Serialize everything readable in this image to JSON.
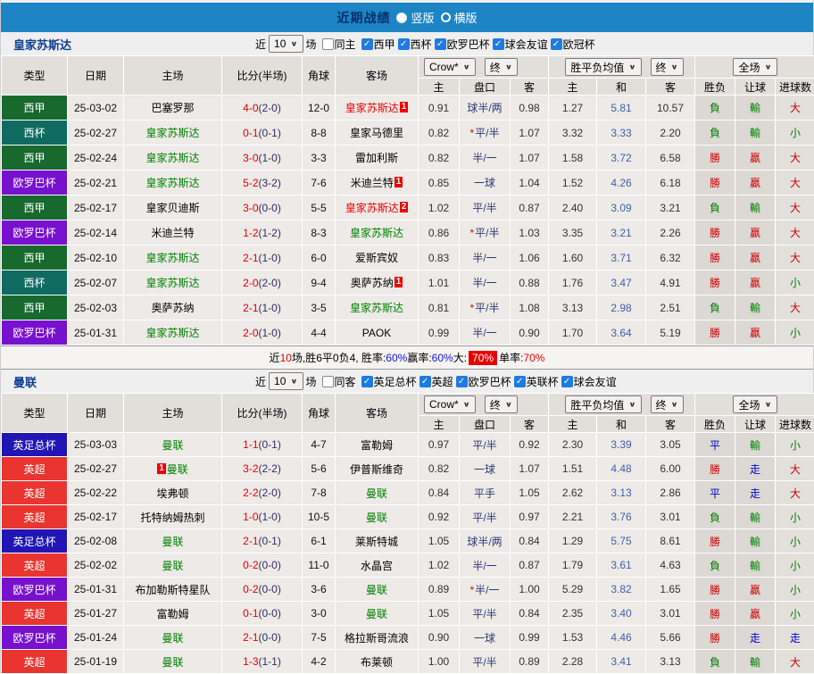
{
  "title_bar": {
    "title": "近期战绩",
    "vertical_label": "竖版",
    "horizontal_label": "横版",
    "selected": "竖版"
  },
  "colors": {
    "accent_bar": "#1d84c5",
    "league": {
      "西甲": "#17692e",
      "西杯": "#0f6a60",
      "欧罗巴杯": "#7711ce",
      "英足总杯": "#2015b5",
      "英超": "#e93430"
    },
    "team": {
      "green": "#018001",
      "red": "#f20000",
      "black": "#000000"
    },
    "result": {
      "red": "#cc0101",
      "green": "#028102",
      "blue": "#0101cc"
    }
  },
  "filter_common": {
    "near": "近",
    "games": "10",
    "games_suffix": "场"
  },
  "columns": {
    "type": "类型",
    "date": "日期",
    "home": "主场",
    "score": "比分(半场)",
    "corner": "角球",
    "away": "客场",
    "odds_home": "主",
    "odds_hcap": "盘口",
    "odds_away": "客",
    "avg_home": "主",
    "avg_draw": "和",
    "avg_away": "客",
    "result_wdl": "胜负",
    "result_hcap": "让球",
    "result_goal": "进球数",
    "select_crow": "Crow*",
    "select_final1": "终",
    "select_avg": "胜平负均值",
    "select_final2": "终",
    "select_full": "全场"
  },
  "sections": [
    {
      "team": "皇家苏斯达",
      "venue_label": "同主",
      "venue_checked": false,
      "leagues": [
        {
          "label": "西甲",
          "checked": true
        },
        {
          "label": "西杯",
          "checked": true
        },
        {
          "label": "欧罗巴杯",
          "checked": true
        },
        {
          "label": "球会友谊",
          "checked": true
        },
        {
          "label": "欧冠杯",
          "checked": true
        }
      ],
      "rows": [
        {
          "lg": "西甲",
          "dt": "25-03-02",
          "hm": {
            "n": "巴塞罗那",
            "c": "black"
          },
          "sc": "4-0",
          "hf": "(2-0)",
          "cn": "12-0",
          "aw": {
            "n": "皇家苏斯达",
            "c": "red",
            "b": "1"
          },
          "o1": "0.91",
          "hc": "球半/两",
          "st": false,
          "o2": "0.98",
          "m1": "1.27",
          "m2": "5.81",
          "m3": "10.57",
          "r1": [
            "負",
            "green"
          ],
          "r2": [
            "輸",
            "green"
          ],
          "r3": [
            "大",
            "red"
          ]
        },
        {
          "lg": "西杯",
          "dt": "25-02-27",
          "hm": {
            "n": "皇家苏斯达",
            "c": "green"
          },
          "sc": "0-1",
          "hf": "(0-1)",
          "cn": "8-8",
          "aw": {
            "n": "皇家马德里",
            "c": "black"
          },
          "o1": "0.82",
          "hc": "平/半",
          "st": true,
          "o2": "1.07",
          "m1": "3.32",
          "m2": "3.33",
          "m3": "2.20",
          "r1": [
            "負",
            "green"
          ],
          "r2": [
            "輸",
            "green"
          ],
          "r3": [
            "小",
            "green"
          ]
        },
        {
          "lg": "西甲",
          "dt": "25-02-24",
          "hm": {
            "n": "皇家苏斯达",
            "c": "green"
          },
          "sc": "3-0",
          "hf": "(1-0)",
          "cn": "3-3",
          "aw": {
            "n": "雷加利斯",
            "c": "black"
          },
          "o1": "0.82",
          "hc": "半/一",
          "st": false,
          "o2": "1.07",
          "m1": "1.58",
          "m2": "3.72",
          "m3": "6.58",
          "r1": [
            "勝",
            "red"
          ],
          "r2": [
            "贏",
            "red"
          ],
          "r3": [
            "大",
            "red"
          ]
        },
        {
          "lg": "欧罗巴杯",
          "dt": "25-02-21",
          "hm": {
            "n": "皇家苏斯达",
            "c": "green"
          },
          "sc": "5-2",
          "hf": "(3-2)",
          "cn": "7-6",
          "aw": {
            "n": "米迪兰特",
            "c": "black",
            "b": "1"
          },
          "o1": "0.85",
          "hc": "一球",
          "st": false,
          "o2": "1.04",
          "m1": "1.52",
          "m2": "4.26",
          "m3": "6.18",
          "r1": [
            "勝",
            "red"
          ],
          "r2": [
            "贏",
            "red"
          ],
          "r3": [
            "大",
            "red"
          ]
        },
        {
          "lg": "西甲",
          "dt": "25-02-17",
          "hm": {
            "n": "皇家贝迪斯",
            "c": "black"
          },
          "sc": "3-0",
          "hf": "(0-0)",
          "cn": "5-5",
          "aw": {
            "n": "皇家苏斯达",
            "c": "red",
            "b": "2"
          },
          "o1": "1.02",
          "hc": "平/半",
          "st": false,
          "o2": "0.87",
          "m1": "2.40",
          "m2": "3.09",
          "m3": "3.21",
          "r1": [
            "負",
            "green"
          ],
          "r2": [
            "輸",
            "green"
          ],
          "r3": [
            "大",
            "red"
          ]
        },
        {
          "lg": "欧罗巴杯",
          "dt": "25-02-14",
          "hm": {
            "n": "米迪兰特",
            "c": "black"
          },
          "sc": "1-2",
          "hf": "(1-2)",
          "cn": "8-3",
          "aw": {
            "n": "皇家苏斯达",
            "c": "green"
          },
          "o1": "0.86",
          "hc": "平/半",
          "st": true,
          "o2": "1.03",
          "m1": "3.35",
          "m2": "3.21",
          "m3": "2.26",
          "r1": [
            "勝",
            "red"
          ],
          "r2": [
            "贏",
            "red"
          ],
          "r3": [
            "大",
            "red"
          ]
        },
        {
          "lg": "西甲",
          "dt": "25-02-10",
          "hm": {
            "n": "皇家苏斯达",
            "c": "green"
          },
          "sc": "2-1",
          "hf": "(1-0)",
          "cn": "6-0",
          "aw": {
            "n": "爱斯宾奴",
            "c": "black"
          },
          "o1": "0.83",
          "hc": "半/一",
          "st": false,
          "o2": "1.06",
          "m1": "1.60",
          "m2": "3.71",
          "m3": "6.32",
          "r1": [
            "勝",
            "red"
          ],
          "r2": [
            "贏",
            "red"
          ],
          "r3": [
            "大",
            "red"
          ]
        },
        {
          "lg": "西杯",
          "dt": "25-02-07",
          "hm": {
            "n": "皇家苏斯达",
            "c": "green"
          },
          "sc": "2-0",
          "hf": "(2-0)",
          "cn": "9-4",
          "aw": {
            "n": "奥萨苏纳",
            "c": "black",
            "b": "1"
          },
          "o1": "1.01",
          "hc": "半/一",
          "st": false,
          "o2": "0.88",
          "m1": "1.76",
          "m2": "3.47",
          "m3": "4.91",
          "r1": [
            "勝",
            "red"
          ],
          "r2": [
            "贏",
            "red"
          ],
          "r3": [
            "小",
            "green"
          ]
        },
        {
          "lg": "西甲",
          "dt": "25-02-03",
          "hm": {
            "n": "奥萨苏纳",
            "c": "black"
          },
          "sc": "2-1",
          "hf": "(1-0)",
          "cn": "3-5",
          "aw": {
            "n": "皇家苏斯达",
            "c": "green"
          },
          "o1": "0.81",
          "hc": "平/半",
          "st": true,
          "o2": "1.08",
          "m1": "3.13",
          "m2": "2.98",
          "m3": "2.51",
          "r1": [
            "負",
            "green"
          ],
          "r2": [
            "輸",
            "green"
          ],
          "r3": [
            "大",
            "red"
          ]
        },
        {
          "lg": "欧罗巴杯",
          "dt": "25-01-31",
          "hm": {
            "n": "皇家苏斯达",
            "c": "green"
          },
          "sc": "2-0",
          "hf": "(1-0)",
          "cn": "4-4",
          "aw": {
            "n": "PAOK",
            "c": "black"
          },
          "o1": "0.99",
          "hc": "半/一",
          "st": false,
          "o2": "0.90",
          "m1": "1.70",
          "m2": "3.64",
          "m3": "5.19",
          "r1": [
            "勝",
            "red"
          ],
          "r2": [
            "贏",
            "red"
          ],
          "r3": [
            "小",
            "green"
          ]
        }
      ],
      "summary": [
        {
          "t": "近",
          "s": "plain"
        },
        {
          "t": "10",
          "s": "red"
        },
        {
          "t": "场,胜6平0负4, 胜率:",
          "s": "plain"
        },
        {
          "t": "60%",
          "s": "blue"
        },
        {
          "t": " 赢率:",
          "s": "plain"
        },
        {
          "t": "60%",
          "s": "blue"
        },
        {
          "t": " 大:",
          "s": "plain"
        },
        {
          "t": "70%",
          "s": "badge"
        },
        {
          "t": " 单率:",
          "s": "plain"
        },
        {
          "t": "70%",
          "s": "red"
        }
      ]
    },
    {
      "team": "曼联",
      "venue_label": "同客",
      "venue_checked": false,
      "leagues": [
        {
          "label": "英足总杯",
          "checked": true
        },
        {
          "label": "英超",
          "checked": true
        },
        {
          "label": "欧罗巴杯",
          "checked": true
        },
        {
          "label": "英联杯",
          "checked": true
        },
        {
          "label": "球会友谊",
          "checked": true
        }
      ],
      "rows": [
        {
          "lg": "英足总杯",
          "dt": "25-03-03",
          "hm": {
            "n": "曼联",
            "c": "green"
          },
          "sc": "1-1",
          "hf": "(0-1)",
          "cn": "4-7",
          "aw": {
            "n": "富勒姆",
            "c": "black"
          },
          "o1": "0.97",
          "hc": "平/半",
          "st": false,
          "o2": "0.92",
          "m1": "2.30",
          "m2": "3.39",
          "m3": "3.05",
          "r1": [
            "平",
            "blue"
          ],
          "r2": [
            "輸",
            "green"
          ],
          "r3": [
            "小",
            "green"
          ]
        },
        {
          "lg": "英超",
          "dt": "25-02-27",
          "hm": {
            "n": "曼联",
            "c": "green",
            "b": "1",
            "bpos": "before"
          },
          "sc": "3-2",
          "hf": "(2-2)",
          "cn": "5-6",
          "aw": {
            "n": "伊普斯维奇",
            "c": "black"
          },
          "o1": "0.82",
          "hc": "一球",
          "st": false,
          "o2": "1.07",
          "m1": "1.51",
          "m2": "4.48",
          "m3": "6.00",
          "r1": [
            "勝",
            "red"
          ],
          "r2": [
            "走",
            "blue"
          ],
          "r3": [
            "大",
            "red"
          ]
        },
        {
          "lg": "英超",
          "dt": "25-02-22",
          "hm": {
            "n": "埃弗顿",
            "c": "black"
          },
          "sc": "2-2",
          "hf": "(2-0)",
          "cn": "7-8",
          "aw": {
            "n": "曼联",
            "c": "green"
          },
          "o1": "0.84",
          "hc": "平手",
          "st": false,
          "o2": "1.05",
          "m1": "2.62",
          "m2": "3.13",
          "m3": "2.86",
          "r1": [
            "平",
            "blue"
          ],
          "r2": [
            "走",
            "blue"
          ],
          "r3": [
            "大",
            "red"
          ]
        },
        {
          "lg": "英超",
          "dt": "25-02-17",
          "hm": {
            "n": "托特纳姆热刺",
            "c": "black"
          },
          "sc": "1-0",
          "hf": "(1-0)",
          "cn": "10-5",
          "aw": {
            "n": "曼联",
            "c": "green"
          },
          "o1": "0.92",
          "hc": "平/半",
          "st": false,
          "o2": "0.97",
          "m1": "2.21",
          "m2": "3.76",
          "m3": "3.01",
          "r1": [
            "負",
            "green"
          ],
          "r2": [
            "輸",
            "green"
          ],
          "r3": [
            "小",
            "green"
          ]
        },
        {
          "lg": "英足总杯",
          "dt": "25-02-08",
          "hm": {
            "n": "曼联",
            "c": "green"
          },
          "sc": "2-1",
          "hf": "(0-1)",
          "cn": "6-1",
          "aw": {
            "n": "莱斯特城",
            "c": "black"
          },
          "o1": "1.05",
          "hc": "球半/两",
          "st": false,
          "o2": "0.84",
          "m1": "1.29",
          "m2": "5.75",
          "m3": "8.61",
          "r1": [
            "勝",
            "red"
          ],
          "r2": [
            "輸",
            "green"
          ],
          "r3": [
            "小",
            "green"
          ]
        },
        {
          "lg": "英超",
          "dt": "25-02-02",
          "hm": {
            "n": "曼联",
            "c": "green"
          },
          "sc": "0-2",
          "hf": "(0-0)",
          "cn": "11-0",
          "aw": {
            "n": "水晶宫",
            "c": "black"
          },
          "o1": "1.02",
          "hc": "半/一",
          "st": false,
          "o2": "0.87",
          "m1": "1.79",
          "m2": "3.61",
          "m3": "4.63",
          "r1": [
            "負",
            "green"
          ],
          "r2": [
            "輸",
            "green"
          ],
          "r3": [
            "小",
            "green"
          ]
        },
        {
          "lg": "欧罗巴杯",
          "dt": "25-01-31",
          "hm": {
            "n": "布加勒斯特星队",
            "c": "black"
          },
          "sc": "0-2",
          "hf": "(0-0)",
          "cn": "3-6",
          "aw": {
            "n": "曼联",
            "c": "green"
          },
          "o1": "0.89",
          "hc": "半/一",
          "st": true,
          "o2": "1.00",
          "m1": "5.29",
          "m2": "3.82",
          "m3": "1.65",
          "r1": [
            "勝",
            "red"
          ],
          "r2": [
            "贏",
            "red"
          ],
          "r3": [
            "小",
            "green"
          ]
        },
        {
          "lg": "英超",
          "dt": "25-01-27",
          "hm": {
            "n": "富勒姆",
            "c": "black"
          },
          "sc": "0-1",
          "hf": "(0-0)",
          "cn": "3-0",
          "aw": {
            "n": "曼联",
            "c": "green"
          },
          "o1": "1.05",
          "hc": "平/半",
          "st": false,
          "o2": "0.84",
          "m1": "2.35",
          "m2": "3.40",
          "m3": "3.01",
          "r1": [
            "勝",
            "red"
          ],
          "r2": [
            "贏",
            "red"
          ],
          "r3": [
            "小",
            "green"
          ]
        },
        {
          "lg": "欧罗巴杯",
          "dt": "25-01-24",
          "hm": {
            "n": "曼联",
            "c": "green"
          },
          "sc": "2-1",
          "hf": "(0-0)",
          "cn": "7-5",
          "aw": {
            "n": "格拉斯哥流浪",
            "c": "black"
          },
          "o1": "0.90",
          "hc": "一球",
          "st": false,
          "o2": "0.99",
          "m1": "1.53",
          "m2": "4.46",
          "m3": "5.66",
          "r1": [
            "勝",
            "red"
          ],
          "r2": [
            "走",
            "blue"
          ],
          "r3": [
            "走",
            "blue"
          ]
        },
        {
          "lg": "英超",
          "dt": "25-01-19",
          "hm": {
            "n": "曼联",
            "c": "green"
          },
          "sc": "1-3",
          "hf": "(1-1)",
          "cn": "4-2",
          "aw": {
            "n": "布莱顿",
            "c": "black"
          },
          "o1": "1.00",
          "hc": "平/半",
          "st": false,
          "o2": "0.89",
          "m1": "2.28",
          "m2": "3.41",
          "m3": "3.13",
          "r1": [
            "負",
            "green"
          ],
          "r2": [
            "輸",
            "green"
          ],
          "r3": [
            "大",
            "red"
          ]
        }
      ]
    }
  ]
}
